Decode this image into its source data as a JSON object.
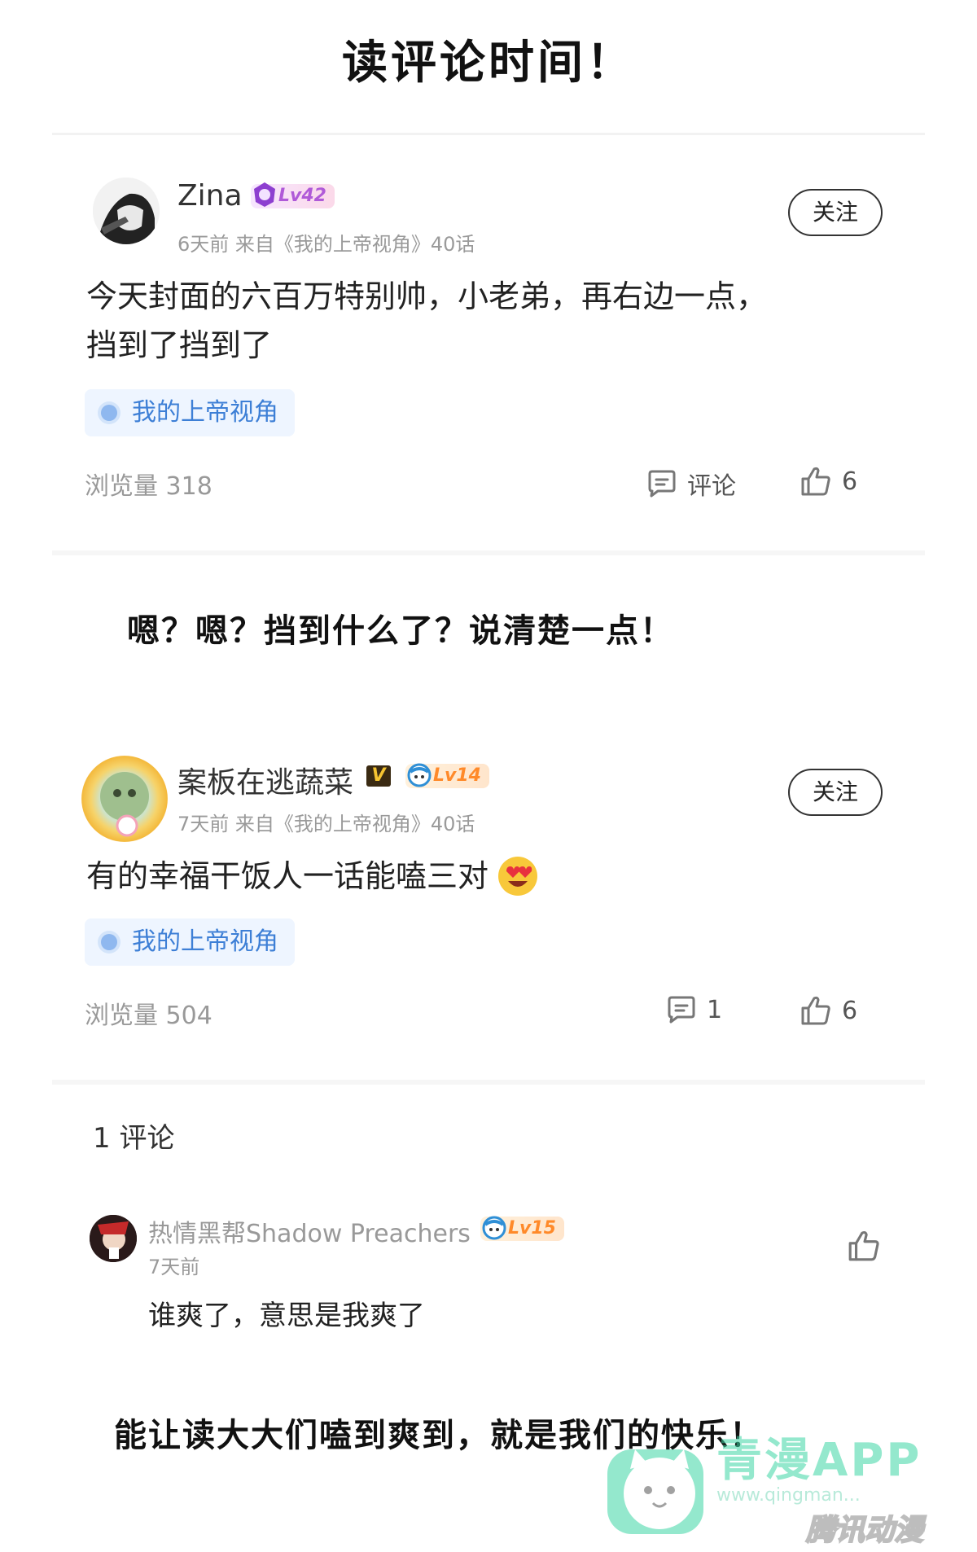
{
  "page_title": "读评论时间！",
  "posts": [
    {
      "username": "Zina",
      "level": "Lv42",
      "meta": "6天前 来自《我的上帝视角》40话",
      "follow_label": "关注",
      "body_lines": [
        "今天封面的六百万特别帅，小老弟，再右边一点，",
        "挡到了挡到了"
      ],
      "tag": "我的上帝视角",
      "views": "浏览量 318",
      "comment_label": "评论",
      "likes": "6"
    },
    {
      "username": "案板在逃蔬菜",
      "vip_badge": "V",
      "level": "Lv14",
      "meta": "7天前 来自《我的上帝视角》40话",
      "follow_label": "关注",
      "body": "有的幸福干饭人一话能嗑三对",
      "tag": "我的上帝视角",
      "views": "浏览量 504",
      "comments": "1",
      "likes": "6"
    }
  ],
  "caption_1": "嗯？嗯？挡到什么了？说清楚一点！",
  "comment_section": {
    "count_label": "1 评论",
    "reply": {
      "username": "热情黑帮Shadow Preachers",
      "level": "Lv15",
      "time": "7天前",
      "body": "谁爽了，意思是我爽了"
    }
  },
  "caption_2": "能让读大大们嗑到爽到，就是我们的快乐！",
  "watermark": {
    "app": "青漫APP",
    "url": "www.qingman...",
    "brand": "腾讯动漫"
  },
  "colors": {
    "accent_blue": "#3d7fd6",
    "level_purple": "#b05ad8",
    "level_orange": "#ff8a2a",
    "watermark_green": "#3dd6a5"
  }
}
